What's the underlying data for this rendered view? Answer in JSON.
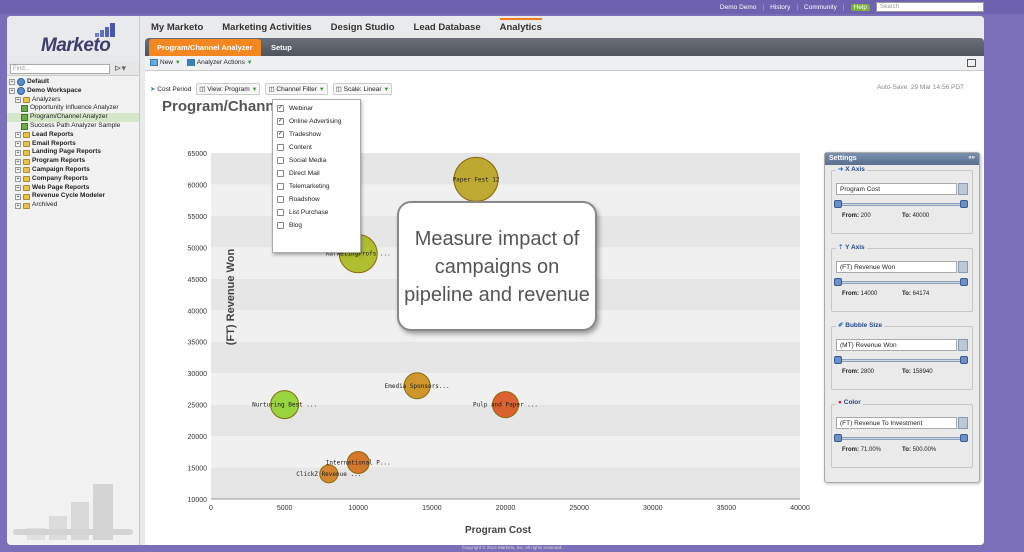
{
  "topbar": {
    "user": "Demo Demo",
    "history": "History",
    "community": "Community",
    "help": "Help",
    "search_placeholder": "Search"
  },
  "logo": {
    "text": "Marketo"
  },
  "finder": {
    "placeholder": "Find..."
  },
  "tree": [
    {
      "label": "Default",
      "bold": true
    },
    {
      "label": "Demo Workspace",
      "bold": true
    },
    {
      "label": "Analyzers",
      "bold": false
    },
    {
      "label": "Opportunity Influence Analyzer",
      "bold": false
    },
    {
      "label": "Program/Channel Analyzer",
      "bold": false
    },
    {
      "label": "Success Path Analyzer Sample",
      "bold": false
    },
    {
      "label": "Lead Reports",
      "bold": true
    },
    {
      "label": "Email Reports",
      "bold": true
    },
    {
      "label": "Landing Page Reports",
      "bold": true
    },
    {
      "label": "Program Reports",
      "bold": true
    },
    {
      "label": "Campaign Reports",
      "bold": true
    },
    {
      "label": "Company Reports",
      "bold": true
    },
    {
      "label": "Web Page Reports",
      "bold": true
    },
    {
      "label": "Revenue Cycle Modeler",
      "bold": true
    },
    {
      "label": "Archived",
      "bold": false
    }
  ],
  "nav": {
    "tabs": [
      "My Marketo",
      "Marketing Activities",
      "Design Studio",
      "Lead Database",
      "Analytics"
    ],
    "active": "Analytics"
  },
  "subtabs": {
    "active": "Program/Channel Analyzer",
    "other": "Setup"
  },
  "toolbar": {
    "new": "New",
    "actions": "Analyzer Actions"
  },
  "toolbar2": {
    "cost_period": "Cost Period",
    "view": "View: Program",
    "channel_filter": "Channel Filter",
    "scale": "Scale: Linear",
    "autosave": "Auto-Save: 29 Mar 14:56 PDT"
  },
  "page_title": "Program/Channel",
  "channel_menu": [
    {
      "label": "Webinar",
      "checked": true
    },
    {
      "label": "Online Advertising",
      "checked": true
    },
    {
      "label": "Tradeshow",
      "checked": true
    },
    {
      "label": "Content",
      "checked": false
    },
    {
      "label": "Social Media",
      "checked": false
    },
    {
      "label": "Direct Mail",
      "checked": false
    },
    {
      "label": "Telemarketing",
      "checked": false
    },
    {
      "label": "Roadshow",
      "checked": false
    },
    {
      "label": "List Purchase",
      "checked": false
    },
    {
      "label": "Blog",
      "checked": false
    }
  ],
  "callout": "Measure impact of campaigns on pipeline and revenue",
  "settings": {
    "title": "Settings",
    "x": {
      "legend": "X Axis",
      "value": "Program Cost",
      "from": "200",
      "to": "40000"
    },
    "y": {
      "legend": "Y Axis",
      "value": "(FT) Revenue Won",
      "from": "14000",
      "to": "64174"
    },
    "size": {
      "legend": "Bubble Size",
      "value": "(MT) Revenue Won",
      "from": "2800",
      "to": "158940"
    },
    "color": {
      "legend": "Color",
      "value": "(FT) Revenue To Investment",
      "from": "71.00%",
      "to": "500.00%"
    },
    "from_label": "From:",
    "to_label": "To:"
  },
  "chart_data": {
    "type": "scatter",
    "xlabel": "Program Cost",
    "ylabel": "(FT) Revenue Won",
    "xlim": [
      0,
      40000
    ],
    "ylim": [
      10000,
      65000
    ],
    "xticks": [
      0,
      5000,
      10000,
      15000,
      20000,
      25000,
      30000,
      35000,
      40000
    ],
    "yticks": [
      10000,
      15000,
      20000,
      25000,
      30000,
      35000,
      40000,
      45000,
      50000,
      55000,
      60000,
      65000
    ],
    "points": [
      {
        "label": "Paper Fest 12",
        "x": 18000,
        "y": 60800,
        "size": 22,
        "color": "#b8a21e"
      },
      {
        "label": "MarketingProfs ...",
        "x": 10000,
        "y": 49000,
        "size": 19,
        "color": "#a9b81c"
      },
      {
        "label": "Emedia Sponsors...",
        "x": 14000,
        "y": 28000,
        "size": 13,
        "color": "#c98d16"
      },
      {
        "label": "Nurturing Best ...",
        "x": 5000,
        "y": 25000,
        "size": 14,
        "color": "#8ed12a"
      },
      {
        "label": "Pulp and Paper ...",
        "x": 20000,
        "y": 25000,
        "size": 13,
        "color": "#d9521a"
      },
      {
        "label": "International P...",
        "x": 10000,
        "y": 15800,
        "size": 11,
        "color": "#d06a16"
      },
      {
        "label": "ClickZ Revenue ...",
        "x": 8000,
        "y": 14000,
        "size": 9,
        "color": "#d07b1c"
      }
    ]
  },
  "footer": "Copyright © 2014 Marketo, Inc. All rights reserved."
}
